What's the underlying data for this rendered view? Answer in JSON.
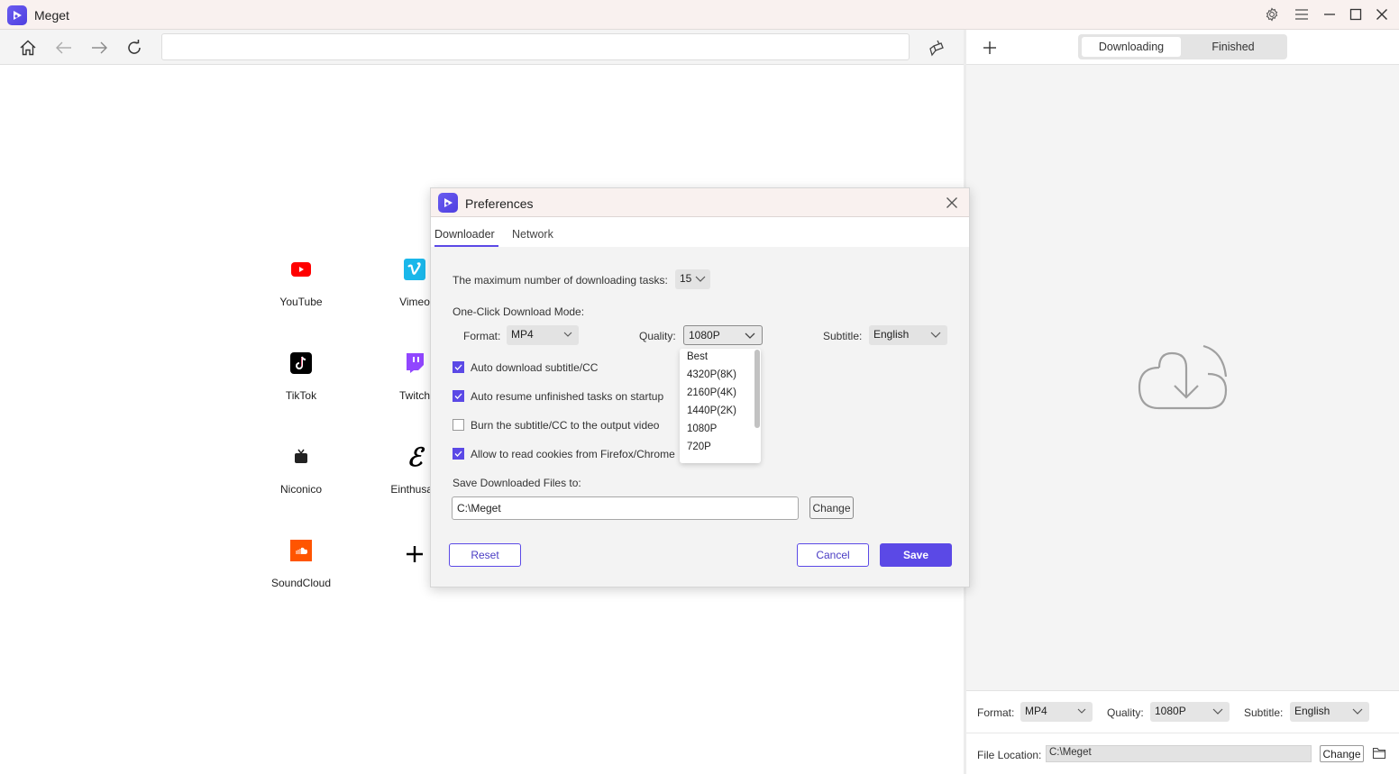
{
  "app": {
    "title": "Meget"
  },
  "window_controls": [
    "settings-icon",
    "menu-icon",
    "minimize-icon",
    "maximize-icon",
    "close-icon"
  ],
  "browser": {
    "url_value": "",
    "nav": [
      "home-icon",
      "back-icon",
      "forward-icon",
      "refresh-icon",
      "clear-icon"
    ]
  },
  "sites": [
    {
      "label": "YouTube",
      "icon": "youtube-icon",
      "color": "#ff0000"
    },
    {
      "label": "Vimeo",
      "icon": "vimeo-icon",
      "color": "#1ab7ea"
    },
    {
      "label": "TikTok",
      "icon": "tiktok-icon",
      "color": "#000000"
    },
    {
      "label": "Twitch",
      "icon": "twitch-icon",
      "color": "#9146ff"
    },
    {
      "label": "Niconico",
      "icon": "niconico-icon",
      "color": "#222222"
    },
    {
      "label": "Einthusan",
      "icon": "einthusan-icon",
      "color": "#000000"
    },
    {
      "label": "SoundCloud",
      "icon": "soundcloud-icon",
      "color": "#ff5500"
    },
    {
      "label": "",
      "icon": "add-site-icon",
      "color": "#000000"
    }
  ],
  "right_panel": {
    "tabs": [
      {
        "label": "Downloading",
        "active": true
      },
      {
        "label": "Finished",
        "active": false
      }
    ],
    "footer": {
      "format_label": "Format:",
      "format_value": "MP4",
      "quality_label": "Quality:",
      "quality_value": "1080P",
      "subtitle_label": "Subtitle:",
      "subtitle_value": "English",
      "location_label": "File Location:",
      "location_value": "C:\\Meget",
      "change_label": "Change"
    }
  },
  "dialog": {
    "title": "Preferences",
    "tabs": [
      {
        "label": "Downloader",
        "active": true
      },
      {
        "label": "Network",
        "active": false
      }
    ],
    "max_tasks_label": "The maximum number of downloading tasks:",
    "max_tasks_value": "15",
    "one_click_label": "One-Click Download Mode:",
    "format_label": "Format:",
    "format_value": "MP4",
    "quality_label": "Quality:",
    "quality_value": "1080P",
    "subtitle_label": "Subtitle:",
    "subtitle_value": "English",
    "checkboxes": [
      {
        "label": "Auto download subtitle/CC",
        "checked": true
      },
      {
        "label": "Auto resume unfinished tasks on startup",
        "checked": true
      },
      {
        "label": "Burn the subtitle/CC to the output video",
        "checked": false
      },
      {
        "label": "Allow to read cookies from Firefox/Chrome",
        "checked": true
      }
    ],
    "save_to_label": "Save Downloaded Files to:",
    "save_to_value": "C:\\Meget",
    "change_label": "Change",
    "reset_label": "Reset",
    "cancel_label": "Cancel",
    "save_label": "Save",
    "quality_options": [
      "Best",
      "4320P(8K)",
      "2160P(4K)",
      "1440P(2K)",
      "1080P",
      "720P"
    ]
  },
  "colors": {
    "accent": "#5b49e6",
    "titlebar": "#f9f1ef"
  }
}
